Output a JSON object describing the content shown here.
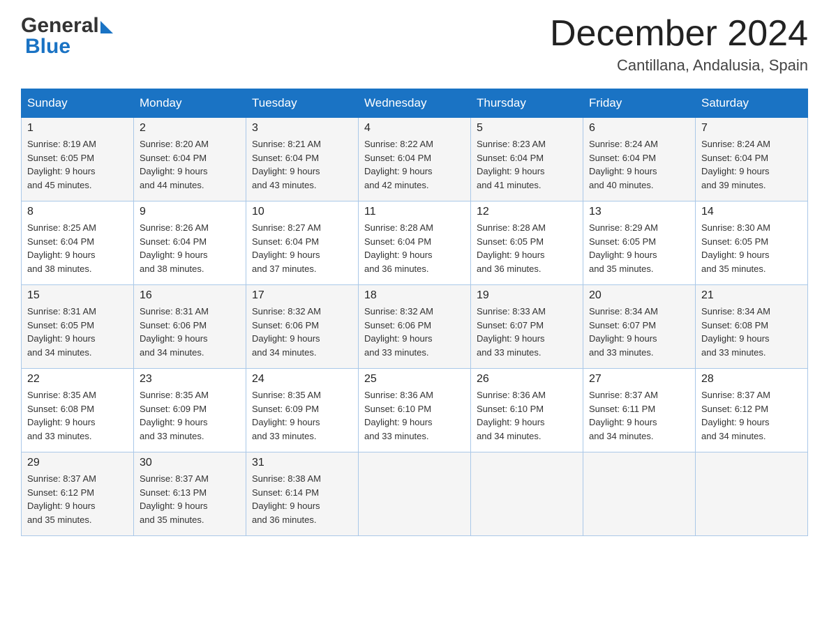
{
  "header": {
    "logo_general": "General",
    "logo_blue": "Blue",
    "month_title": "December 2024",
    "location": "Cantillana, Andalusia, Spain"
  },
  "days_of_week": [
    "Sunday",
    "Monday",
    "Tuesday",
    "Wednesday",
    "Thursday",
    "Friday",
    "Saturday"
  ],
  "weeks": [
    [
      {
        "day": "1",
        "sunrise": "8:19 AM",
        "sunset": "6:05 PM",
        "daylight": "9 hours and 45 minutes."
      },
      {
        "day": "2",
        "sunrise": "8:20 AM",
        "sunset": "6:04 PM",
        "daylight": "9 hours and 44 minutes."
      },
      {
        "day": "3",
        "sunrise": "8:21 AM",
        "sunset": "6:04 PM",
        "daylight": "9 hours and 43 minutes."
      },
      {
        "day": "4",
        "sunrise": "8:22 AM",
        "sunset": "6:04 PM",
        "daylight": "9 hours and 42 minutes."
      },
      {
        "day": "5",
        "sunrise": "8:23 AM",
        "sunset": "6:04 PM",
        "daylight": "9 hours and 41 minutes."
      },
      {
        "day": "6",
        "sunrise": "8:24 AM",
        "sunset": "6:04 PM",
        "daylight": "9 hours and 40 minutes."
      },
      {
        "day": "7",
        "sunrise": "8:24 AM",
        "sunset": "6:04 PM",
        "daylight": "9 hours and 39 minutes."
      }
    ],
    [
      {
        "day": "8",
        "sunrise": "8:25 AM",
        "sunset": "6:04 PM",
        "daylight": "9 hours and 38 minutes."
      },
      {
        "day": "9",
        "sunrise": "8:26 AM",
        "sunset": "6:04 PM",
        "daylight": "9 hours and 38 minutes."
      },
      {
        "day": "10",
        "sunrise": "8:27 AM",
        "sunset": "6:04 PM",
        "daylight": "9 hours and 37 minutes."
      },
      {
        "day": "11",
        "sunrise": "8:28 AM",
        "sunset": "6:04 PM",
        "daylight": "9 hours and 36 minutes."
      },
      {
        "day": "12",
        "sunrise": "8:28 AM",
        "sunset": "6:05 PM",
        "daylight": "9 hours and 36 minutes."
      },
      {
        "day": "13",
        "sunrise": "8:29 AM",
        "sunset": "6:05 PM",
        "daylight": "9 hours and 35 minutes."
      },
      {
        "day": "14",
        "sunrise": "8:30 AM",
        "sunset": "6:05 PM",
        "daylight": "9 hours and 35 minutes."
      }
    ],
    [
      {
        "day": "15",
        "sunrise": "8:31 AM",
        "sunset": "6:05 PM",
        "daylight": "9 hours and 34 minutes."
      },
      {
        "day": "16",
        "sunrise": "8:31 AM",
        "sunset": "6:06 PM",
        "daylight": "9 hours and 34 minutes."
      },
      {
        "day": "17",
        "sunrise": "8:32 AM",
        "sunset": "6:06 PM",
        "daylight": "9 hours and 34 minutes."
      },
      {
        "day": "18",
        "sunrise": "8:32 AM",
        "sunset": "6:06 PM",
        "daylight": "9 hours and 33 minutes."
      },
      {
        "day": "19",
        "sunrise": "8:33 AM",
        "sunset": "6:07 PM",
        "daylight": "9 hours and 33 minutes."
      },
      {
        "day": "20",
        "sunrise": "8:34 AM",
        "sunset": "6:07 PM",
        "daylight": "9 hours and 33 minutes."
      },
      {
        "day": "21",
        "sunrise": "8:34 AM",
        "sunset": "6:08 PM",
        "daylight": "9 hours and 33 minutes."
      }
    ],
    [
      {
        "day": "22",
        "sunrise": "8:35 AM",
        "sunset": "6:08 PM",
        "daylight": "9 hours and 33 minutes."
      },
      {
        "day": "23",
        "sunrise": "8:35 AM",
        "sunset": "6:09 PM",
        "daylight": "9 hours and 33 minutes."
      },
      {
        "day": "24",
        "sunrise": "8:35 AM",
        "sunset": "6:09 PM",
        "daylight": "9 hours and 33 minutes."
      },
      {
        "day": "25",
        "sunrise": "8:36 AM",
        "sunset": "6:10 PM",
        "daylight": "9 hours and 33 minutes."
      },
      {
        "day": "26",
        "sunrise": "8:36 AM",
        "sunset": "6:10 PM",
        "daylight": "9 hours and 34 minutes."
      },
      {
        "day": "27",
        "sunrise": "8:37 AM",
        "sunset": "6:11 PM",
        "daylight": "9 hours and 34 minutes."
      },
      {
        "day": "28",
        "sunrise": "8:37 AM",
        "sunset": "6:12 PM",
        "daylight": "9 hours and 34 minutes."
      }
    ],
    [
      {
        "day": "29",
        "sunrise": "8:37 AM",
        "sunset": "6:12 PM",
        "daylight": "9 hours and 35 minutes."
      },
      {
        "day": "30",
        "sunrise": "8:37 AM",
        "sunset": "6:13 PM",
        "daylight": "9 hours and 35 minutes."
      },
      {
        "day": "31",
        "sunrise": "8:38 AM",
        "sunset": "6:14 PM",
        "daylight": "9 hours and 36 minutes."
      },
      null,
      null,
      null,
      null
    ]
  ],
  "labels": {
    "sunrise": "Sunrise:",
    "sunset": "Sunset:",
    "daylight": "Daylight:"
  }
}
